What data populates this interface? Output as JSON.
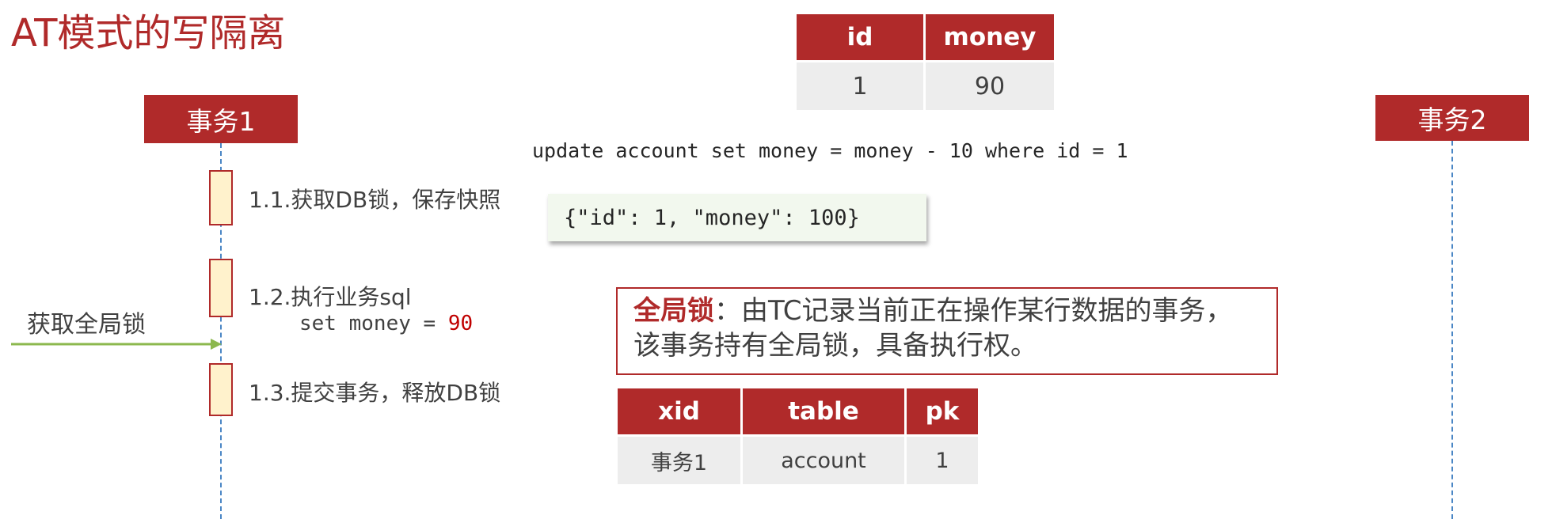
{
  "title": "AT模式的写隔离",
  "account_table": {
    "headers": [
      "id",
      "money"
    ],
    "row": [
      "1",
      "90"
    ]
  },
  "actors": {
    "tx1": "事务1",
    "tx2": "事务2"
  },
  "sql_statement": "update account set money = money - 10 where id = 1",
  "steps": {
    "s1": "1.1.获取DB锁，保存快照",
    "s2_line1": "1.2.执行业务sql",
    "s2_line2_prefix": "set money = ",
    "s2_line2_value": "90",
    "s3": "1.3.提交事务，释放DB锁"
  },
  "snapshot": "{\"id\": 1, \"money\": 100}",
  "global_lock_label": "获取全局锁",
  "global_lock_note": {
    "keyword": "全局锁",
    "line1_rest": "：由TC记录当前正在操作某行数据的事务，",
    "line2": "该事务持有全局锁，具备执行权。"
  },
  "lock_table": {
    "headers": [
      "xid",
      "table",
      "pk"
    ],
    "row": [
      "事务1",
      "account",
      "1"
    ]
  },
  "colors": {
    "accent_red": "#b02a2a",
    "lifeline_blue": "#4a86c5",
    "arrow_green": "#8cb84e",
    "activation_fill": "#fff2cc",
    "table_cell_gray": "#ededed"
  }
}
